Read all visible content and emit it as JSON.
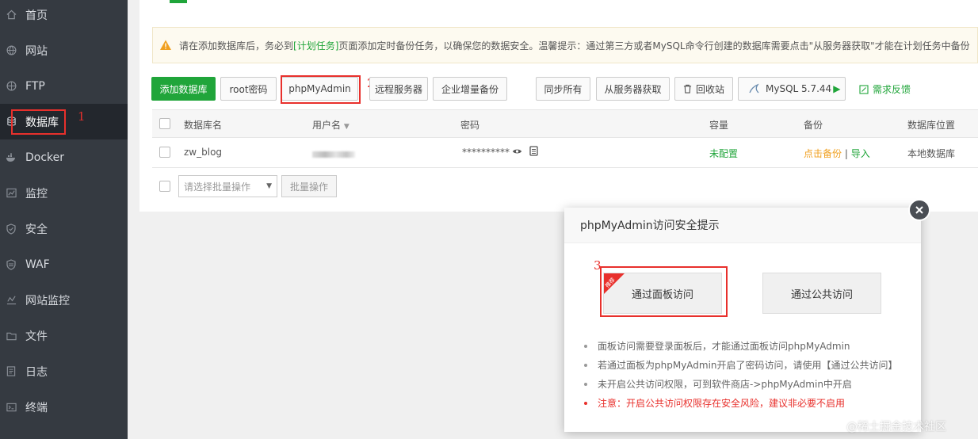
{
  "sidebar": {
    "items": [
      {
        "label": "首页",
        "icon": "home-icon"
      },
      {
        "label": "网站",
        "icon": "globe-icon"
      },
      {
        "label": "FTP",
        "icon": "ftp-globe-icon"
      },
      {
        "label": "数据库",
        "icon": "database-icon",
        "active": true
      },
      {
        "label": "Docker",
        "icon": "docker-icon"
      },
      {
        "label": "监控",
        "icon": "monitor-chart-icon"
      },
      {
        "label": "安全",
        "icon": "shield-icon"
      },
      {
        "label": "WAF",
        "icon": "waf-shield-icon"
      },
      {
        "label": "网站监控",
        "icon": "site-monitor-icon"
      },
      {
        "label": "文件",
        "icon": "folder-icon"
      },
      {
        "label": "日志",
        "icon": "log-icon"
      },
      {
        "label": "终端",
        "icon": "terminal-icon"
      }
    ]
  },
  "annotations": {
    "one": "1",
    "two": "2",
    "three": "3"
  },
  "warning": {
    "prefix": "请在添加数据库后，务必到",
    "link": "[计划任务]",
    "suffix": "页面添加定时备份任务，以确保您的数据安全。温馨提示：通过第三方或者MySQL命令行创建的数据库需要点击\"从服务器获取\"才能在计划任务中备份"
  },
  "toolbar": {
    "add_db": "添加数据库",
    "root_pwd": "root密码",
    "phpmyadmin": "phpMyAdmin",
    "remote_server": "远程服务器",
    "enterprise_backup": "企业增量备份",
    "sync_all": "同步所有",
    "fetch_server": "从服务器获取",
    "recycle": "回收站",
    "mysql_version": "MySQL 5.7.44",
    "feedback": "需求反馈"
  },
  "table": {
    "headers": {
      "name": "数据库名",
      "user": "用户名",
      "password": "密码",
      "capacity": "容量",
      "backup": "备份",
      "location": "数据库位置"
    },
    "rows": [
      {
        "name": "zw_blog",
        "password": "**********",
        "capacity": "未配置",
        "backup_action": "点击备份",
        "sep": "|",
        "import_action": "导入",
        "location": "本地数据库"
      }
    ]
  },
  "batch": {
    "select_placeholder": "请选择批量操作",
    "button": "批量操作"
  },
  "modal": {
    "title": "phpMyAdmin访问安全提示",
    "ribbon": "推荐",
    "panel_access": "通过面板访问",
    "public_access": "通过公共访问",
    "notes": [
      "面板访问需要登录面板后，才能通过面板访问phpMyAdmin",
      "若通过面板为phpMyAdmin开启了密码访问，请使用【通过公共访问】",
      "未开启公共访问权限，可到软件商店->phpMyAdmin中开启"
    ],
    "danger_note": "注意：开启公共访问权限存在安全风险，建议非必要不启用"
  },
  "watermark": "@稀土掘金技术社区",
  "colors": {
    "accent": "#20a53a",
    "sidebar_bg": "#353a41",
    "annotation_red": "#e8302c",
    "backup_orange": "#f0a020"
  }
}
